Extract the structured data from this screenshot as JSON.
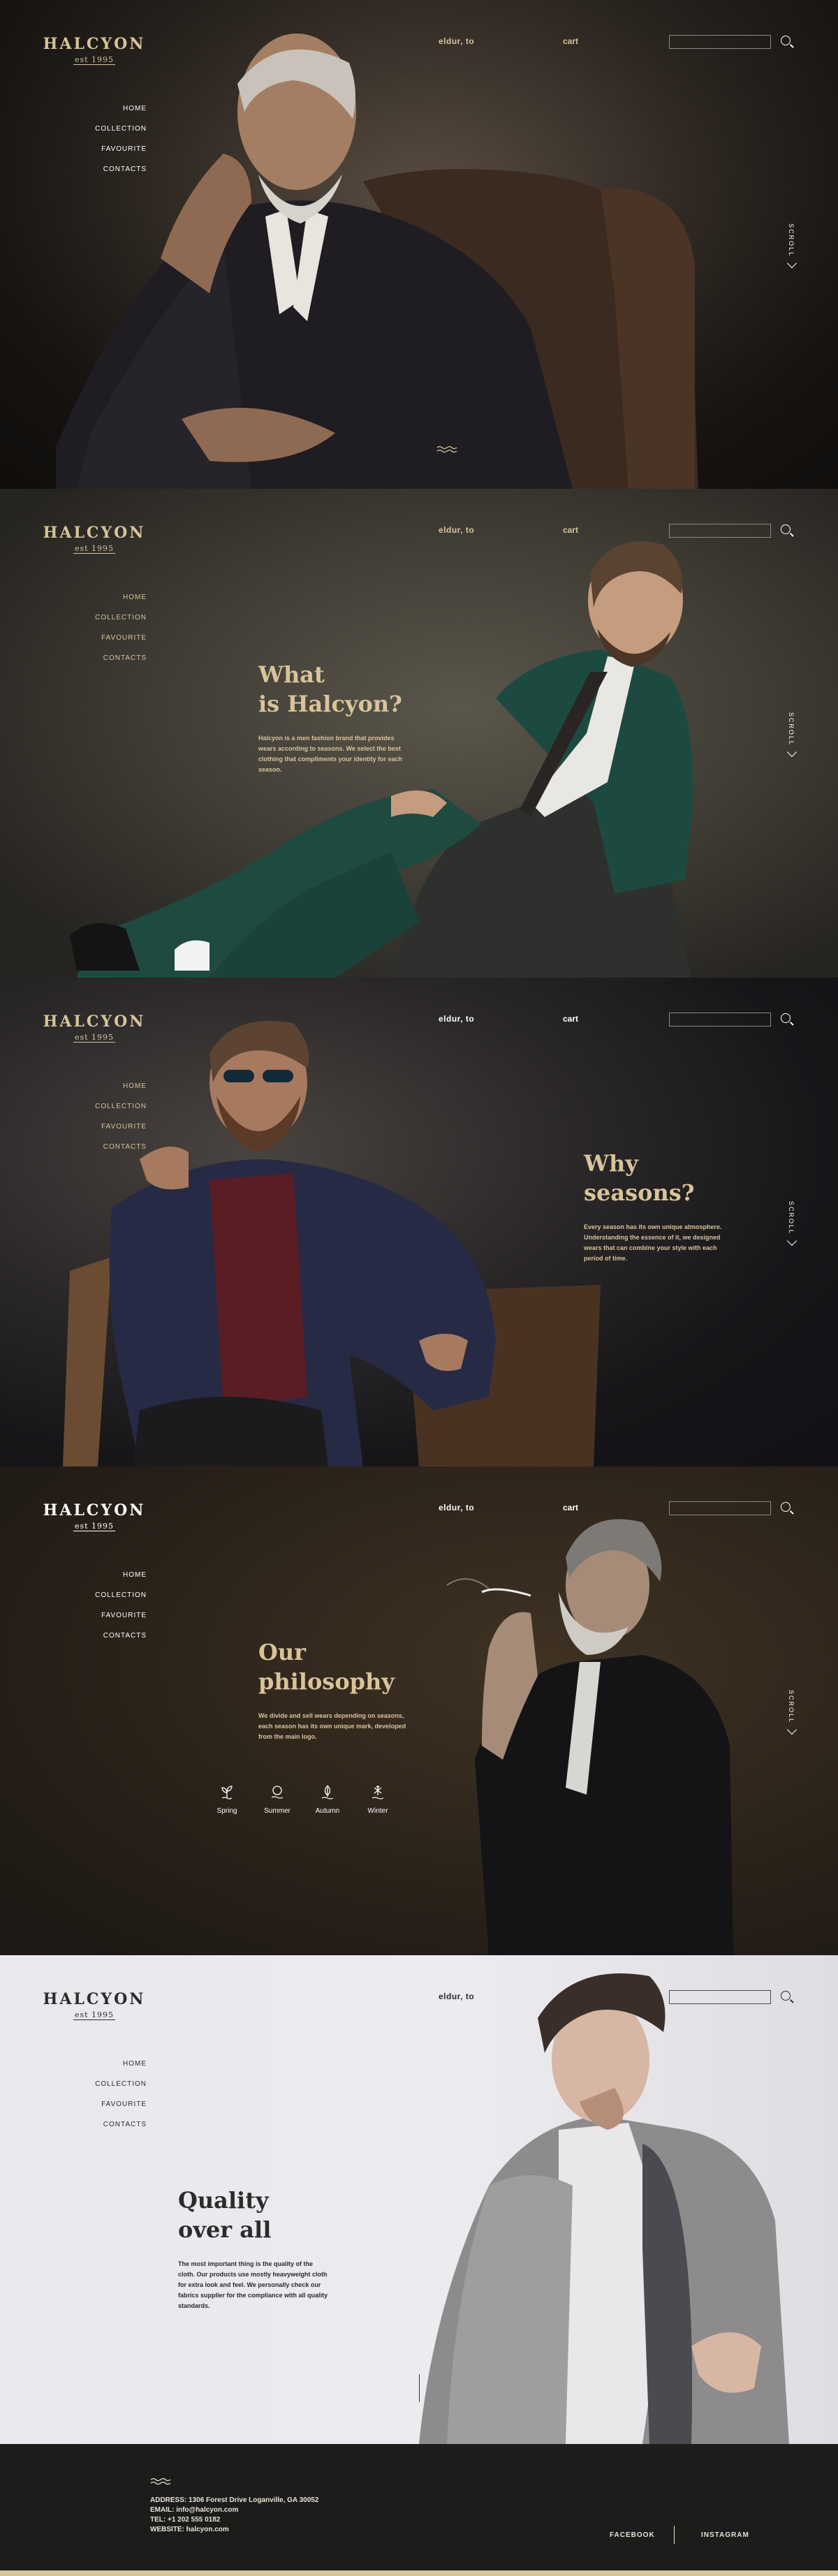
{
  "brand": {
    "name": "HALCYON",
    "est": "est 1995"
  },
  "nav": [
    "HOME",
    "COLLECTION",
    "FAVOURITE",
    "CONTACTS"
  ],
  "header": {
    "lang": "eldur, to",
    "cart": "cart",
    "search_placeholder": ""
  },
  "scroll_label": "SCROLL",
  "sections": {
    "what": {
      "title_line1": "What",
      "title_line2": "is Halcyon?",
      "text": "Halcyon is a men fashion brand that provides wears according to seasons. We select the best clothing that compliments your identity for each season."
    },
    "why": {
      "title_line1": "Why",
      "title_line2": "seasons?",
      "text": "Every season has its own unique atmosphere. Understanding the essence of it, we designed wears that can combine your style with each period of time."
    },
    "philosophy": {
      "title_line1": "Our",
      "title_line2": "philosophy",
      "text": "We divide and sell wears depending on seasons, each season has its own unique mark, developed from the main logo.",
      "seasons": [
        "Spring",
        "Summer",
        "Autumn",
        "Winter"
      ]
    },
    "quality": {
      "title_line1": "Quality",
      "title_line2": "over all",
      "text": "The most important thing is the quality of the cloth. Our products use mostly heavyweight cloth for extra look and feel. We personally check our fabrics supplier for the compliance with all quality standards."
    }
  },
  "footer": {
    "address": "ADDRESS: 1306 Forest Drive Loganville, GA 30052",
    "email": "EMAIL: info@halcyon.com",
    "tel": "TEL: +1 202 555 0182",
    "website": "WEBSITE: halcyon.com",
    "facebook": "FACEBOOK",
    "instagram": "INSTAGRAM"
  },
  "colors": {
    "gold": "#d8c49a",
    "dark_bg": "#1c1c1a",
    "light_bg": "#ecebef"
  }
}
